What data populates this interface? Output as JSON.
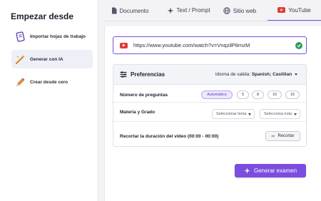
{
  "sidebar": {
    "title": "Empezar desde",
    "items": [
      {
        "label": "Importar hojas de trabajo",
        "icon": "worksheet-icon"
      },
      {
        "label": "Generar con IA",
        "icon": "magic-wand-icon"
      },
      {
        "label": "Crear desde cero",
        "icon": "pencil-icon"
      }
    ]
  },
  "tabs": [
    {
      "label": "Documento",
      "icon": "document-icon"
    },
    {
      "label": "Text / Prompt",
      "icon": "sparkle-icon"
    },
    {
      "label": "Sitio web",
      "icon": "globe-icon"
    },
    {
      "label": "YouTube",
      "icon": "youtube-icon"
    }
  ],
  "url_input": {
    "value": "https://www.youtube.com/watch?v=VnqzilP8mzM"
  },
  "preferences": {
    "title": "Preferencias",
    "language_label": "Idioma de salida:",
    "language_value": "Spanish; Castilian",
    "questions_label": "Número de preguntas",
    "question_options": [
      "Automático",
      "5",
      "8",
      "10",
      "15"
    ],
    "subject_label": "Materia y Grado",
    "subject_placeholder": "Seleccionar tema",
    "grade_placeholder": "Selecciona nota",
    "trim_label": "Recortar la duración del vídeo (00:00 - 00:00)",
    "trim_button": "Recortar"
  },
  "generate_button": "Generar examen",
  "colors": {
    "accent": "#7c4dde",
    "youtube": "#e23b3b",
    "success": "#2e9e5b"
  }
}
